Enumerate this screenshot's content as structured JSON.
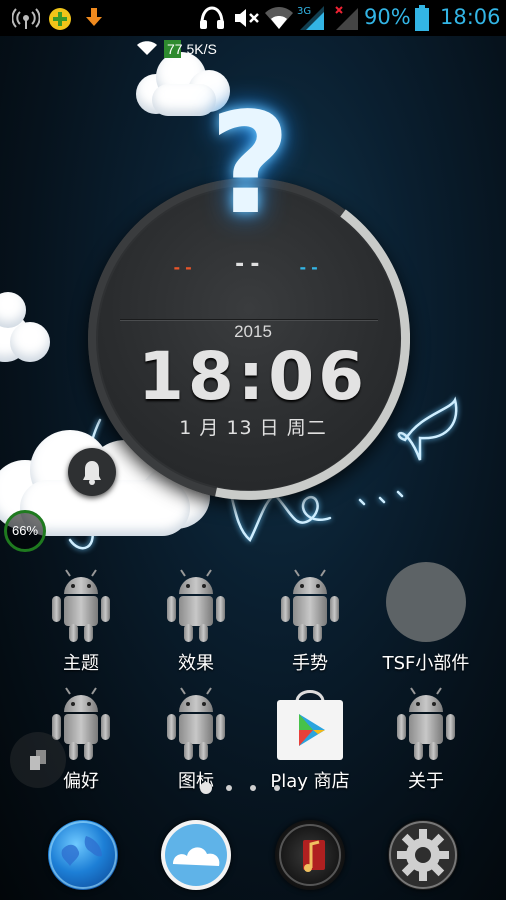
{
  "status_bar": {
    "network_speed": "77.5K/S",
    "network_type": "3G",
    "battery_percent": "90%",
    "time": "18:06",
    "icons": [
      "wifi-hotspot-icon",
      "plus-app-icon",
      "download-icon",
      "headphones-icon",
      "mute-icon",
      "wifi-icon",
      "signal-3g-icon",
      "signal-no-sim-icon",
      "battery-icon"
    ]
  },
  "clock_widget": {
    "weather_placeholder": "?",
    "low_temp": "--",
    "current_temp": "--",
    "high_temp": "--",
    "year": "2015",
    "time": "18:06",
    "date": "1 月 13 日 周二",
    "accent_colors": {
      "low": "#e8552a",
      "high": "#33b5e5"
    }
  },
  "overlays": {
    "battery_badge": "66%",
    "background_text": "Love..."
  },
  "apps": [
    {
      "label": "主题",
      "icon": "android-robot-icon"
    },
    {
      "label": "效果",
      "icon": "android-robot-icon"
    },
    {
      "label": "手势",
      "icon": "android-robot-icon"
    },
    {
      "label": "TSF小部件",
      "icon": "tsf-widget-icon"
    },
    {
      "label": "偏好",
      "icon": "android-robot-icon"
    },
    {
      "label": "图标",
      "icon": "android-robot-icon"
    },
    {
      "label": "Play 商店",
      "icon": "play-store-icon"
    },
    {
      "label": "关于",
      "icon": "android-robot-icon"
    }
  ],
  "page_indicator": {
    "count": 4,
    "current": 1
  },
  "dock": [
    {
      "icon": "browser-globe-icon"
    },
    {
      "icon": "weather-icon"
    },
    {
      "icon": "music-icon"
    },
    {
      "icon": "settings-gear-icon"
    }
  ]
}
